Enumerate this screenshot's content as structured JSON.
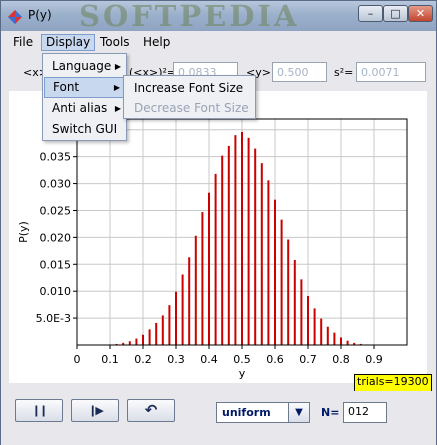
{
  "window": {
    "title": "P(y)",
    "watermark": "SOFTPEDIA",
    "buttons": {
      "minimize": "–",
      "maximize": "□",
      "close": "✕"
    }
  },
  "menubar": {
    "file": "File",
    "display": "Display",
    "tools": "Tools",
    "help": "Help"
  },
  "display_menu": {
    "items": [
      {
        "label": "Language",
        "has_submenu": true
      },
      {
        "label": "Font",
        "has_submenu": true
      },
      {
        "label": "Anti alias",
        "has_submenu": true
      },
      {
        "label": "Switch GUI",
        "has_submenu": false
      }
    ],
    "submenu_arrow": "▶"
  },
  "font_submenu": {
    "items": [
      {
        "label": "Increase Font Size",
        "enabled": true
      },
      {
        "label": "Decrease Font Size",
        "enabled": false
      }
    ]
  },
  "stats": {
    "mean_label": "<x>",
    "mean_sq_label": "(<x>)²=",
    "mean_sq_value": "0.0833",
    "y_mean_label": "<y>=",
    "y_mean_value": "0.500",
    "s2_label": "s²=",
    "s2_value": "0.0071"
  },
  "chart_data": {
    "type": "bar",
    "xlabel": "y",
    "ylabel": "P(y)",
    "xlim": [
      0,
      1.0
    ],
    "ylim": [
      0,
      0.042
    ],
    "x_ticks": [
      "0",
      "0.1",
      "0.2",
      "0.3",
      "0.4",
      "0.5",
      "0.6",
      "0.7",
      "0.8",
      "0.9"
    ],
    "y_ticks": [
      {
        "value": 0.005,
        "label": "5.0E-3"
      },
      {
        "value": 0.01,
        "label": "0.010"
      },
      {
        "value": 0.015,
        "label": "0.015"
      },
      {
        "value": 0.02,
        "label": "0.020"
      },
      {
        "value": 0.025,
        "label": "0.025"
      },
      {
        "value": 0.03,
        "label": "0.030"
      },
      {
        "value": 0.035,
        "label": "0.035"
      }
    ],
    "grid": true,
    "bar_color": "#cc0000",
    "series": [
      {
        "x": [
          0.1,
          0.12,
          0.14,
          0.16,
          0.18,
          0.2,
          0.22,
          0.24,
          0.26,
          0.28,
          0.3,
          0.32,
          0.34,
          0.36,
          0.38,
          0.4,
          0.42,
          0.44,
          0.46,
          0.48,
          0.5,
          0.52,
          0.54,
          0.56,
          0.58,
          0.6,
          0.62,
          0.64,
          0.66,
          0.68,
          0.7,
          0.72,
          0.74,
          0.76,
          0.78,
          0.8,
          0.82,
          0.84,
          0.86,
          0.88
        ],
        "values": [
          0.0001,
          0.0002,
          0.0004,
          0.0007,
          0.0012,
          0.0019,
          0.0029,
          0.0041,
          0.0055,
          0.0074,
          0.0099,
          0.0131,
          0.0163,
          0.0203,
          0.0247,
          0.0283,
          0.0318,
          0.0352,
          0.037,
          0.039,
          0.0396,
          0.0385,
          0.0365,
          0.0338,
          0.0306,
          0.027,
          0.0233,
          0.0196,
          0.0158,
          0.0122,
          0.0091,
          0.0068,
          0.0049,
          0.0034,
          0.0023,
          0.0014,
          0.0008,
          0.0004,
          0.0002,
          0.0001
        ]
      }
    ]
  },
  "trials": "trials=19300",
  "controls": {
    "pause_icon": "❙❙",
    "step_icon": "❙▶",
    "reset_icon": "↶",
    "distribution": "uniform",
    "dropdown_arrow": "▼",
    "n_label": "N=",
    "n_value": "012"
  }
}
